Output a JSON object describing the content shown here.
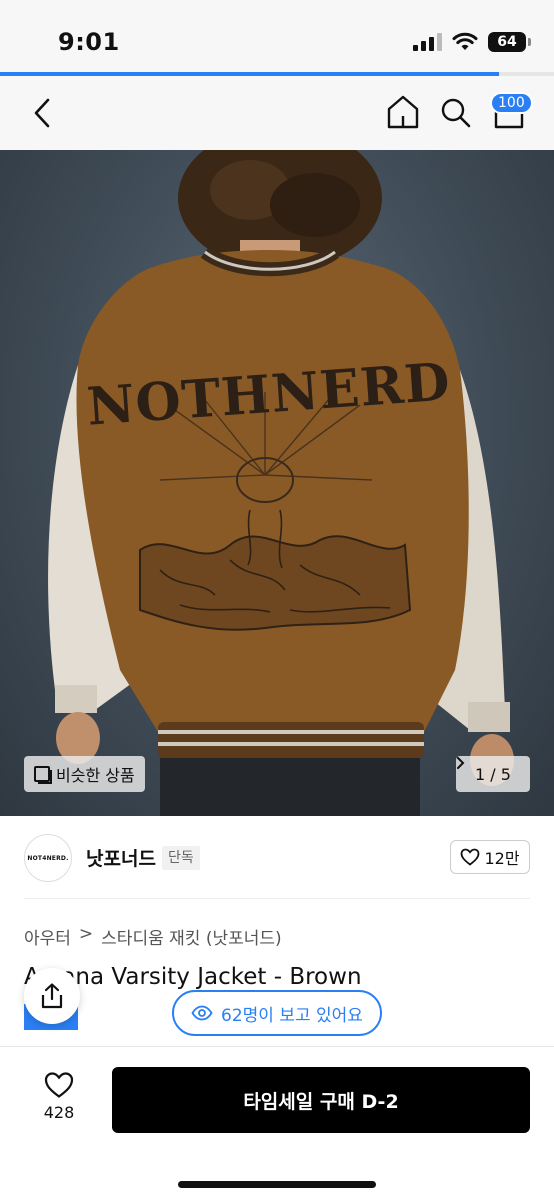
{
  "status_bar": {
    "time": "9:01",
    "battery": "64"
  },
  "page_load_progress": 0.9,
  "nav": {
    "cart_badge": "100"
  },
  "hero": {
    "jacket_graphic_text": "NOTHNERD",
    "similar_button_label": "비슷한 상품",
    "image_counter": "1 / 5"
  },
  "brand": {
    "logo_text": "NOT4NERD.",
    "name": "낫포너드",
    "tag": "단독",
    "likes": "12만"
  },
  "breadcrumb": {
    "category": "아우터",
    "separator": ">",
    "subcategory": "스타디움 재킷 (낫포너드)"
  },
  "product": {
    "title": "Arcana Varsity Jacket - Brown"
  },
  "watching_label": "62명이 보고 있어요",
  "bottom_bar": {
    "wish_count": "428",
    "buy_label": "타임세일 구매 D-2"
  },
  "colors": {
    "accent": "#2a7ff4",
    "buy_button": "#000000",
    "jacket_body": "#8a5a26",
    "sleeves": "#e3ddd3"
  }
}
